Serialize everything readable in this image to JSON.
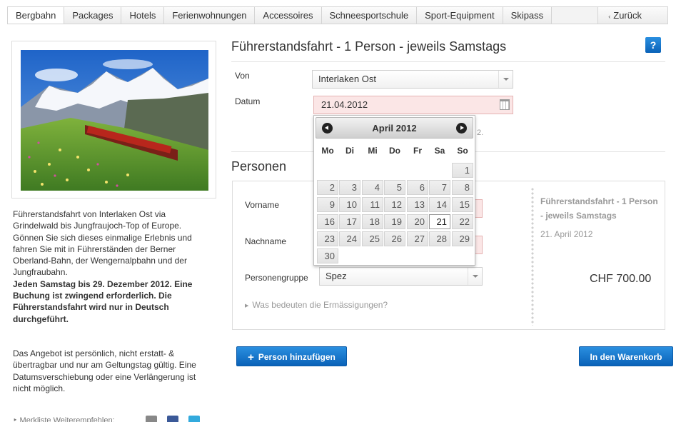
{
  "nav": {
    "tabs": [
      "Bergbahn",
      "Packages",
      "Hotels",
      "Ferienwohnungen",
      "Accessoires",
      "Schneesportschule",
      "Sport-Equipment",
      "Skipass"
    ],
    "back_label": "Zurück"
  },
  "left": {
    "description": "Führerstandsfahrt von Interlaken Ost via Grindelwald bis Jungfraujoch-Top of Europe. Gönnen Sie sich dieses einmalige Erlebnis und fahren Sie mit in Führerständen der Berner Oberland-Bahn, der Wengernalpbahn und der Jungfraubahn.",
    "description_bold": "Jeden Samstag bis 29. Dezember 2012. Eine Buchung ist zwingend erforderlich. Die Führerstandsfahrt wird nur in Deutsch durchgeführt.",
    "terms": "Das Angebot ist persönlich, nicht erstatt- & übertragbar und nur am Geltungstag gültig. Eine Datumsverschiebung oder eine Verlängerung ist nicht möglich.",
    "bottom_links": "‣ Merkliste    Weiterempfehlen:"
  },
  "product": {
    "title": "Führerstandsfahrt - 1 Person - jeweils Samstags",
    "help_label": "?",
    "von_label": "Von",
    "von_value": "Interlaken Ost",
    "datum_label": "Datum",
    "datum_value": "21.04.2012",
    "hint_tail": "2."
  },
  "datepicker": {
    "month_title": "April 2012",
    "weekdays": [
      "Mo",
      "Di",
      "Mi",
      "Do",
      "Fr",
      "Sa",
      "So"
    ],
    "first_weekday_index": 6,
    "days_in_month": 30,
    "selected_day": 21
  },
  "persons": {
    "section_title": "Personen",
    "vorname_label": "Vorname",
    "nachname_label": "Nachname",
    "gruppe_label": "Personengruppe",
    "gruppe_value": "Spez",
    "more_link": "Was bedeuten die Ermässigungen?"
  },
  "summary": {
    "title": "Führerstandsfahrt - 1 Person - jeweils Samstags",
    "date": "21. April 2012",
    "price": "CHF 700.00"
  },
  "actions": {
    "add_person": "Person hinzufügen",
    "add_to_cart": "In den Warenkorb"
  },
  "colors": {
    "accent_blue": "#0a62b8",
    "error_bg": "#fbe6e6",
    "error_border": "#e5b3b3"
  }
}
